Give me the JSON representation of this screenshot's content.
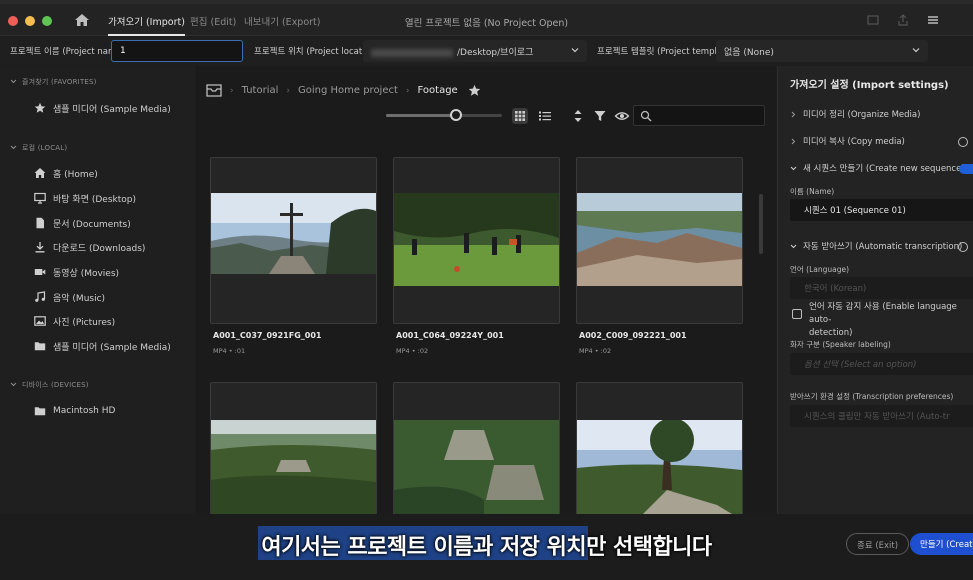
{
  "tabs": [
    {
      "label": "가져오기 (Import)",
      "active": true
    },
    {
      "label": "편집 (Edit)",
      "active": false
    },
    {
      "label": "내보내기 (Export)",
      "active": false
    }
  ],
  "window_title": "열린 프로젝트 없음 (No Project Open)",
  "project": {
    "name_label": "프로젝트 이름 (Project name)",
    "name_value": "1",
    "location_label": "프로젝트 위치 (Project location)",
    "location_value": "/Desktop/브이로그",
    "template_label": "프로젝트 템플릿 (Project template)",
    "template_value": "없음 (None)"
  },
  "sidebar": {
    "favorites_header": "즐겨찾기 (FAVORITES)",
    "favorites": [
      {
        "label": "샘플 미디어 (Sample Media)",
        "icon": "star-icon"
      }
    ],
    "local_header": "로컬 (LOCAL)",
    "local": [
      {
        "label": "홈 (Home)",
        "icon": "home-icon"
      },
      {
        "label": "바탕 화면 (Desktop)",
        "icon": "desktop-icon"
      },
      {
        "label": "문서 (Documents)",
        "icon": "document-icon"
      },
      {
        "label": "다운로드 (Downloads)",
        "icon": "download-icon"
      },
      {
        "label": "동영상 (Movies)",
        "icon": "video-icon"
      },
      {
        "label": "음악 (Music)",
        "icon": "music-icon"
      },
      {
        "label": "사진 (Pictures)",
        "icon": "picture-icon"
      },
      {
        "label": "샘플 미디어 (Sample Media)",
        "icon": "folder-icon"
      }
    ],
    "devices_header": "디바이스 (DEVICES)",
    "devices": [
      {
        "label": "Macintosh HD",
        "icon": "folder-icon"
      }
    ]
  },
  "breadcrumb": [
    "Tutorial",
    "Going Home project",
    "Footage"
  ],
  "thumbnail_size": 0.6,
  "clips": [
    {
      "name": "A001_C037_0921FG_001",
      "meta": "MP4 • :01"
    },
    {
      "name": "A001_C064_09224Y_001",
      "meta": "MP4 • :02"
    },
    {
      "name": "A002_C009_092221_001",
      "meta": "MP4 • :02"
    },
    {
      "name": "",
      "meta": ""
    },
    {
      "name": "",
      "meta": ""
    },
    {
      "name": "",
      "meta": ""
    }
  ],
  "import_settings": {
    "title": "가져오기 설정 (Import settings)",
    "organize_media": "미디어 정리 (Organize Media)",
    "copy_media": "미디어 복사 (Copy media)",
    "create_sequence": "새 시퀀스 만들기 (Create new sequence)",
    "name_label": "이름 (Name)",
    "sequence_name": "시퀀스 01 (Sequence 01)",
    "auto_transcription": "자동 받아쓰기 (Automatic transcription)",
    "language_label": "언어 (Language)",
    "language_value": "한국어 (Korean)",
    "auto_detect_line1": "언어 자동 감지 사용 (Enable language auto-",
    "auto_detect_line2": "detection)",
    "speaker_label": "화자 구분 (Speaker labeling)",
    "speaker_value": "옵션 선택 (Select an option)",
    "prefs_label": "받아쓰기 환경 설정 (Transcription preferences)",
    "prefs_value": "시퀀스의 클립만 자동 받아쓰기 (Auto-tr"
  },
  "buttons": {
    "exit": "종료 (Exit)",
    "create": "만들기 (Create)"
  },
  "subtitle": "여기서는 프로젝트 이름과 저장 위치만 선택합니다",
  "colors": {
    "accent": "#1f4fd1",
    "input_border": "#3a6fb5"
  }
}
